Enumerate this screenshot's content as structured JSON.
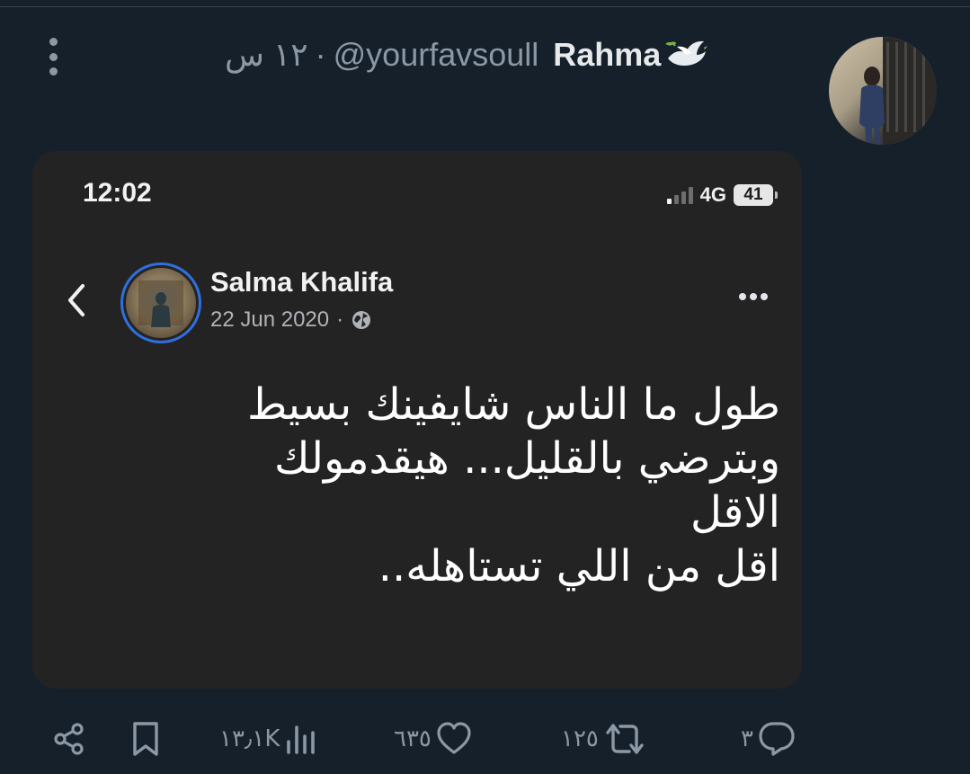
{
  "tweet": {
    "display_name": "Rahma",
    "handle": "@yourfavsoull",
    "time_ago": "١٢ س",
    "separator": "·",
    "emoji_icon": "dove-icon"
  },
  "screenshot": {
    "status_bar": {
      "time": "12:02",
      "network": "4G",
      "battery": "41"
    },
    "post": {
      "author": "Salma Khalifa",
      "date": "22 Jun 2020",
      "meta_separator": "·",
      "audience_icon": "globe-icon",
      "text_lines": [
        "طول ما الناس شايفينك بسيط",
        "وبترضي بالقليل... هيقدمولك",
        "الاقل",
        "اقل من اللي تستاهله.."
      ]
    }
  },
  "actions": {
    "replies": "٣",
    "retweets": "١٢٥",
    "likes": "٦٣٥",
    "views": "١٣٫١K"
  },
  "colors": {
    "background": "#15202b",
    "secondary_text": "#8b98a5",
    "primary_text": "#e7e9ea",
    "screenshot_background": "#232323",
    "avatar_ring": "#2f6fe0"
  }
}
